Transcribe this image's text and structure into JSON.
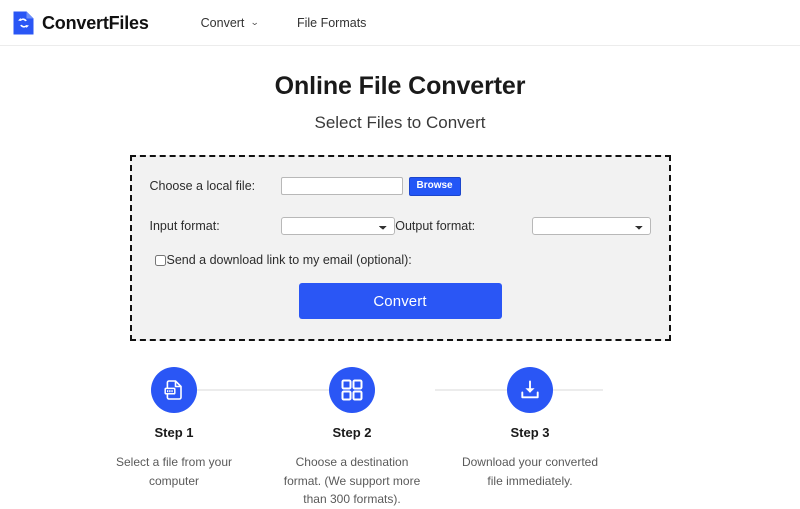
{
  "header": {
    "brand_name": "ConvertFiles",
    "logo_icon": "file-sync-icon",
    "nav": [
      {
        "label": "Convert",
        "icon": "chevron-down-icon",
        "has_caret": true
      },
      {
        "label": "File Formats",
        "has_caret": false
      }
    ]
  },
  "hero": {
    "title": "Online File Converter",
    "subtitle": "Select Files to Convert"
  },
  "form": {
    "local_file_label": "Choose a local file:",
    "file_input_value": "",
    "file_input_placeholder": "",
    "browse_label": "Browse",
    "input_format_label": "Input format:",
    "input_format_value": "",
    "output_format_label": "Output format:",
    "output_format_value": "",
    "email_checkbox_label": "Send a download link to my email (optional):",
    "email_checkbox_checked": false,
    "convert_label": "Convert"
  },
  "steps": [
    {
      "title": "Step 1",
      "desc": "Select a file from your computer",
      "icon": "file-upload-icon"
    },
    {
      "title": "Step 2",
      "desc": "Choose a destination format. (We support more than 300 formats).",
      "icon": "grid-squares-icon"
    },
    {
      "title": "Step 3",
      "desc": "Download your converted file immediately.",
      "icon": "download-icon"
    }
  ],
  "colors": {
    "accent_blue": "#2a56f5",
    "browse_blue": "#2356f6",
    "form_bg": "#f2f2f2",
    "border_dash": "#111111",
    "connector_gray": "#ececec"
  }
}
